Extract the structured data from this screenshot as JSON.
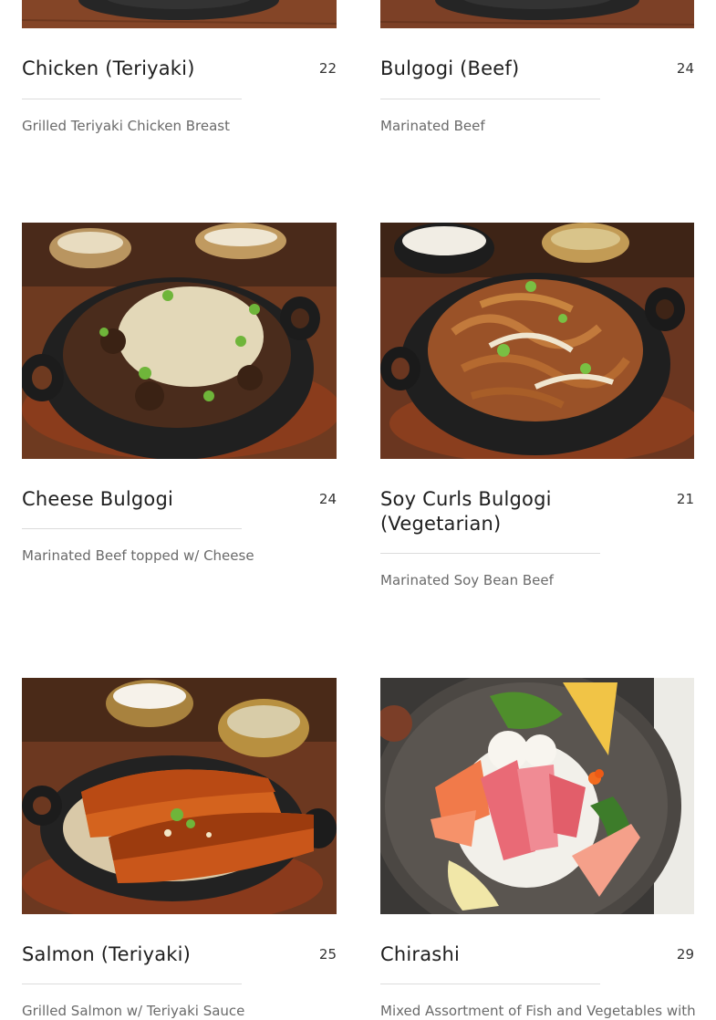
{
  "menu": {
    "items": [
      {
        "name": "Chicken (Teriyaki)",
        "price": "22",
        "description": "Grilled Teriyaki Chicken Breast"
      },
      {
        "name": "Bulgogi (Beef)",
        "price": "24",
        "description": "Marinated Beef"
      },
      {
        "name": "Cheese Bulgogi",
        "price": "24",
        "description": "Marinated Beef topped w/ Cheese"
      },
      {
        "name": "Soy Curls Bulgogi (Vegetarian)",
        "price": "21",
        "description": "Marinated Soy Bean Beef"
      },
      {
        "name": "Salmon (Teriyaki)",
        "price": "25",
        "description": "Grilled Salmon w/ Teriyaki Sauce"
      },
      {
        "name": "Chirashi",
        "price": "29",
        "description": "Mixed Assortment of Fish and Vegetables with"
      }
    ]
  }
}
